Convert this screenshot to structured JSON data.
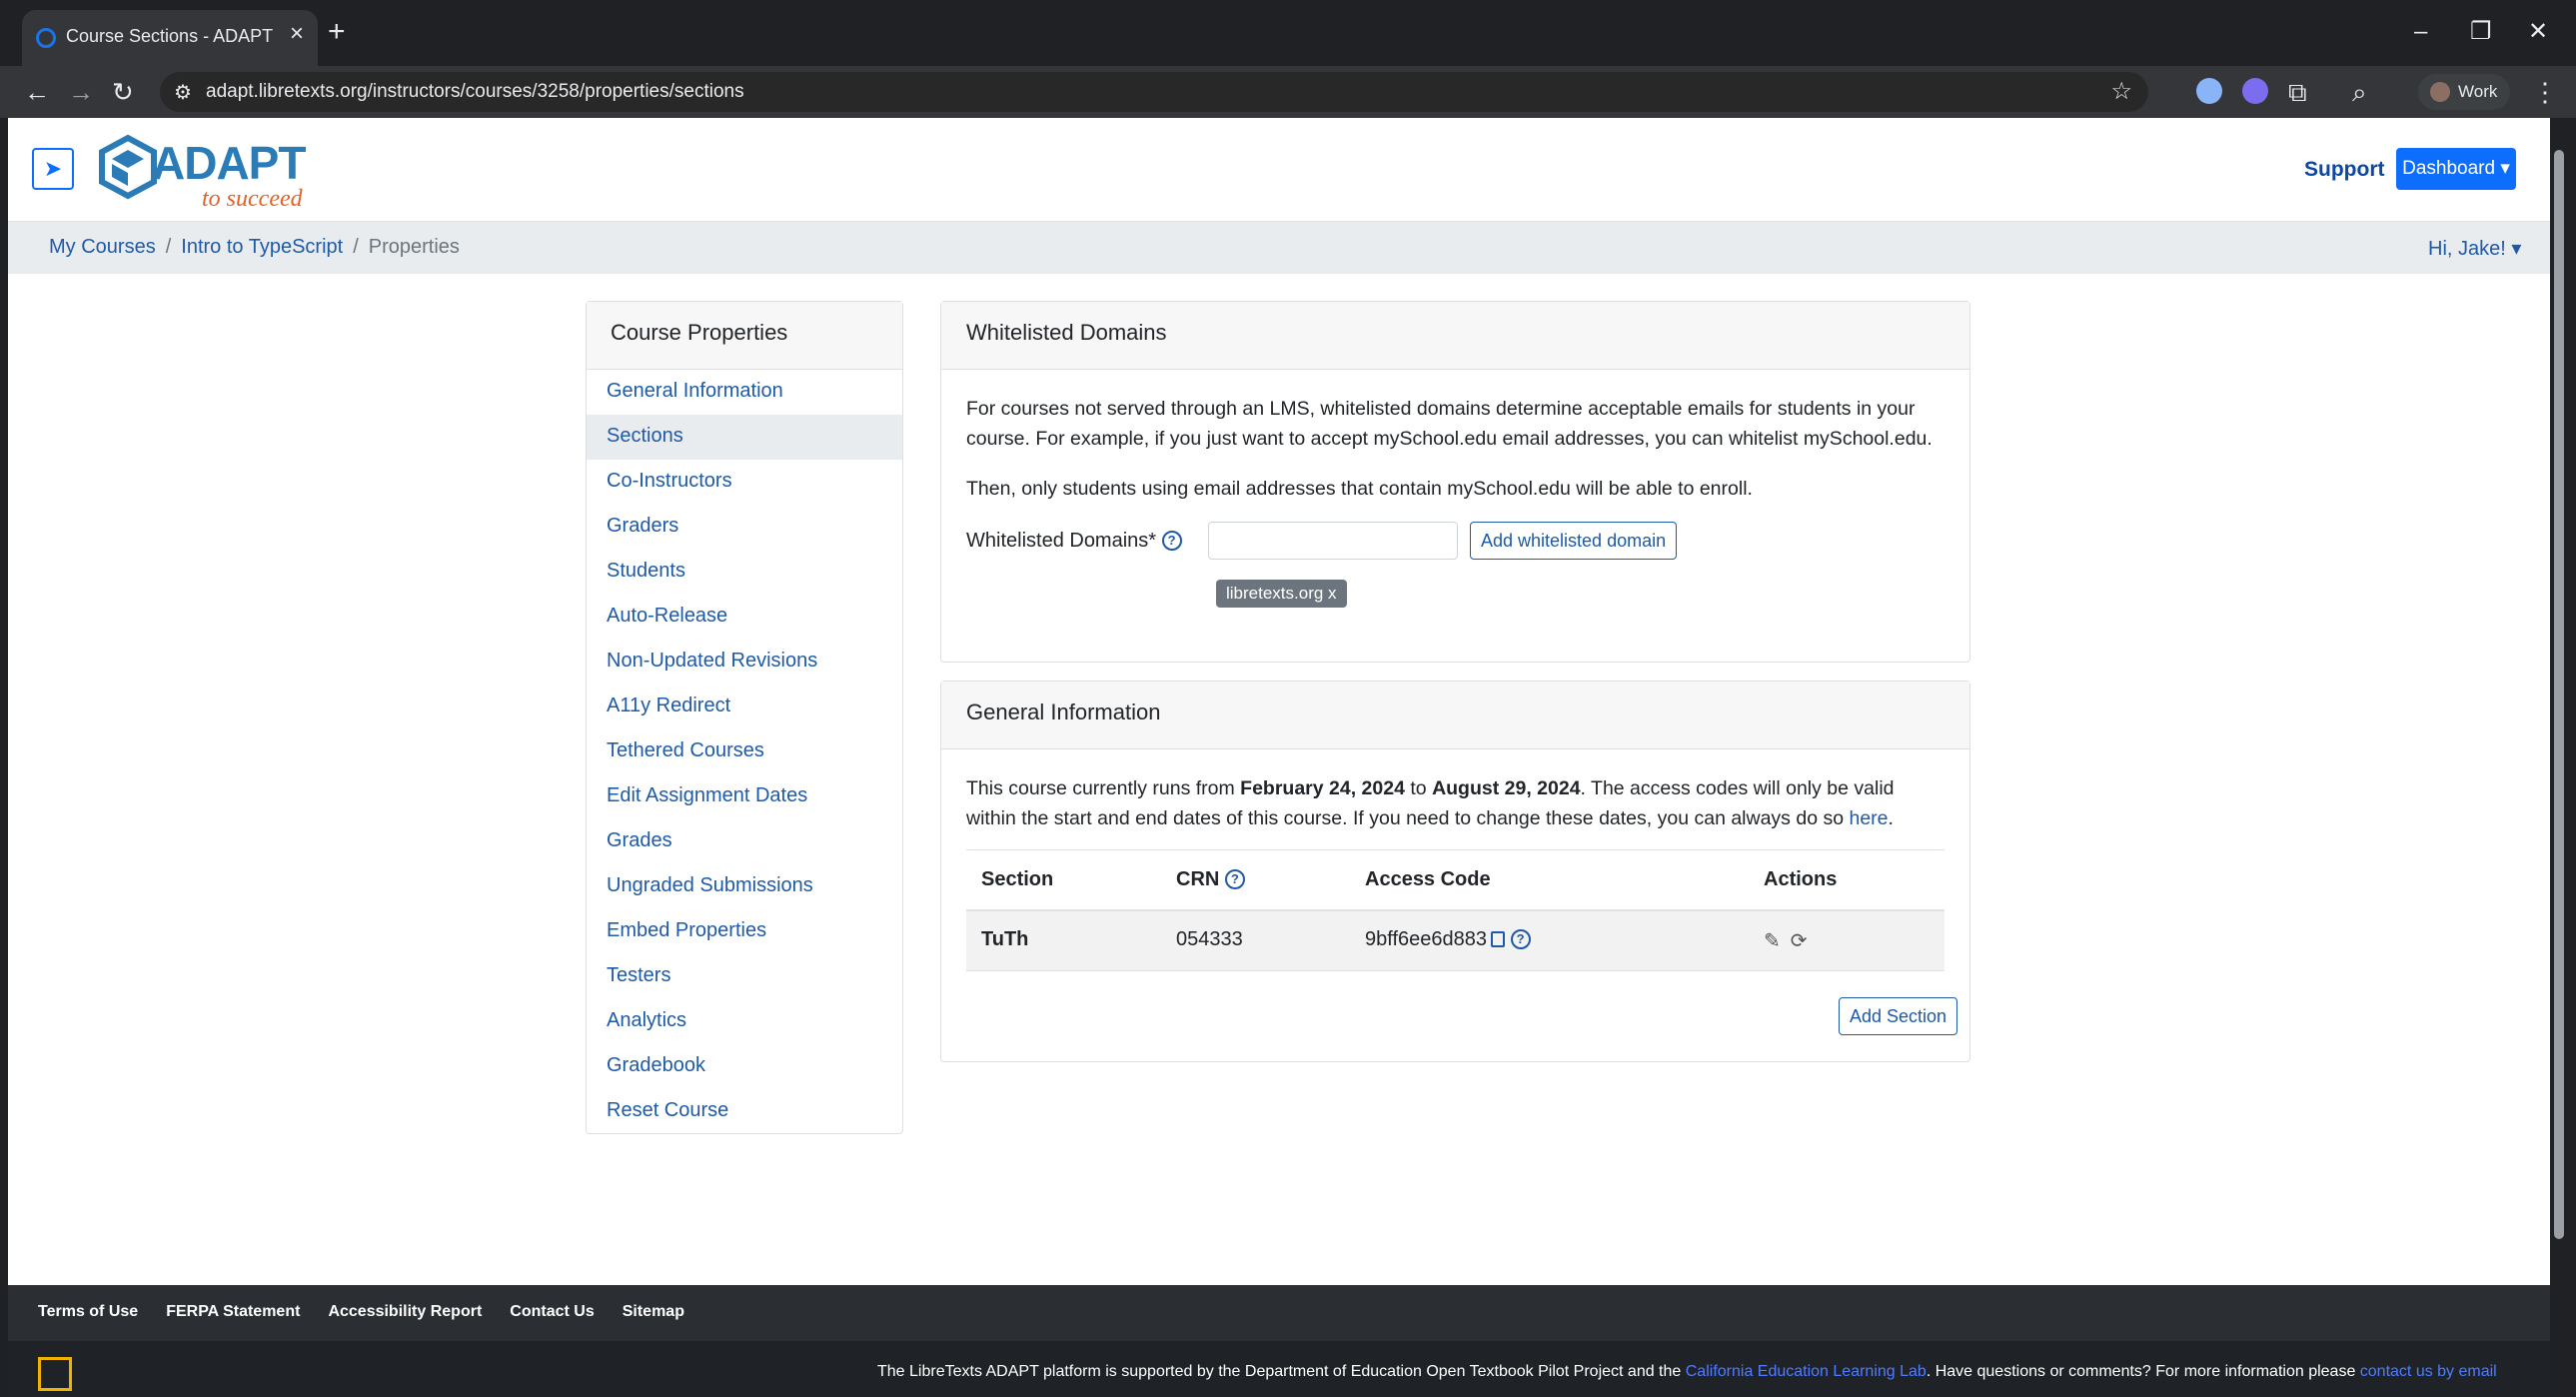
{
  "browser": {
    "tab_title": "Course Sections - ADAPT",
    "url": "adapt.libretexts.org/instructors/courses/3258/properties/sections",
    "profile_label": "Work"
  },
  "header": {
    "logo_text": "ADAPT",
    "logo_tagline": "to succeed",
    "support": "Support",
    "dashboard": "Dashboard"
  },
  "breadcrumb": {
    "items": [
      "My Courses",
      "Intro to TypeScript"
    ],
    "current": "Properties",
    "sep": "/",
    "user": "Hi, Jake!"
  },
  "sidebar": {
    "title": "Course Properties",
    "items": [
      "General Information",
      "Sections",
      "Co-Instructors",
      "Graders",
      "Students",
      "Auto-Release",
      "Non-Updated Revisions",
      "A11y Redirect",
      "Tethered Courses",
      "Edit Assignment Dates",
      "Grades",
      "Ungraded Submissions",
      "Embed Properties",
      "Testers",
      "Analytics",
      "Gradebook",
      "Reset Course"
    ],
    "active": "Sections"
  },
  "whitelist": {
    "title": "Whitelisted Domains",
    "p1": "For courses not served through an LMS, whitelisted domains determine acceptable emails for students in your course. For example, if you just want to accept mySchool.edu email addresses, you can whitelist mySchool.edu.",
    "p2": "Then, only students using email addresses that contain mySchool.edu will be able to enroll.",
    "label": "Whitelisted Domains*",
    "input_value": "",
    "add_button": "Add whitelisted domain",
    "chip": "libretexts.org x"
  },
  "general": {
    "title": "General Information",
    "text_a": "This course currently runs from ",
    "start": "February 24, 2024",
    "text_b": " to ",
    "end": "August 29, 2024",
    "text_c": ". The access codes will only be valid within the start and end dates of this course. If you need to change these dates, you can always do so ",
    "link": "here",
    "text_d": ".",
    "columns": [
      "Section",
      "CRN",
      "Access Code",
      "Actions"
    ],
    "rows": [
      {
        "section": "TuTh",
        "crn": "054333",
        "access_code": "9bff6ee6d883"
      }
    ],
    "add_section": "Add Section"
  },
  "footer": {
    "links": [
      "Terms of Use",
      "FERPA Statement",
      "Accessibility Report",
      "Contact Us",
      "Sitemap"
    ],
    "note_a": "The LibreTexts ADAPT platform is supported by the Department of Education Open Textbook Pilot Project and the ",
    "note_link": "California Education Learning Lab",
    "note_b": ". Have questions or comments? For more information please ",
    "note_link2": "contact us by email"
  },
  "icons": {
    "accent": "#0d6efd",
    "link": "#1f5aa6"
  }
}
